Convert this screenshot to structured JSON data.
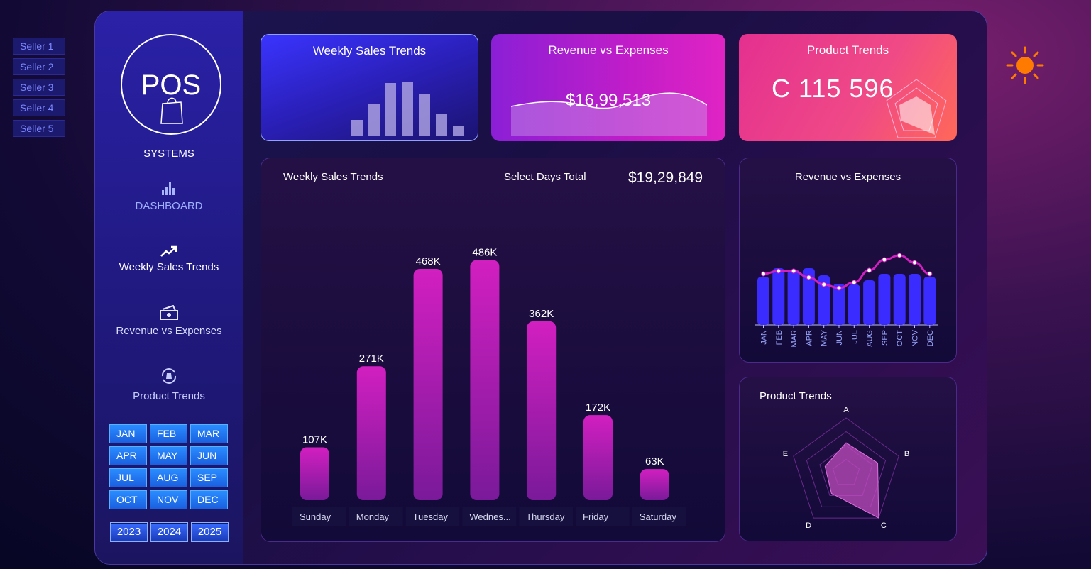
{
  "sellers": [
    "Seller 1",
    "Seller 2",
    "Seller 3",
    "Seller 4",
    "Seller 5"
  ],
  "logo": {
    "text": "POS",
    "subtitle": "SYSTEMS"
  },
  "nav": {
    "dashboard": "DASHBOARD",
    "weekly": "Weekly Sales Trends",
    "revenue": "Revenue vs Expenses",
    "product": "Product Trends"
  },
  "months": [
    "JAN",
    "FEB",
    "MAR",
    "APR",
    "MAY",
    "JUN",
    "JUL",
    "AUG",
    "SEP",
    "OCT",
    "NOV",
    "DEC"
  ],
  "years": [
    "2023",
    "2024",
    "2025"
  ],
  "cards": {
    "weekly_title": "Weekly Sales Trends",
    "revenue_title": "Revenue vs Expenses",
    "revenue_value": "$16,99,513",
    "product_title": "Product Trends",
    "product_value": "C  115 596"
  },
  "main_panel": {
    "title": "Weekly Sales Trends",
    "total_label": "Select Days Total",
    "total_value": "$19,29,849"
  },
  "rev_panel": {
    "title": "Revenue vs Expenses"
  },
  "prod_panel": {
    "title": "Product Trends"
  },
  "colors": {
    "accent_magenta": "#d21fc0",
    "bar_blue": "#3a2cff",
    "sun": "#ff7a00"
  },
  "chart_data": [
    {
      "type": "bar",
      "categories": [
        "Sunday",
        "Monday",
        "Tuesday",
        "Wednes...",
        "Thursday",
        "Friday",
        "Saturday"
      ],
      "values": [
        107,
        271,
        468,
        486,
        362,
        172,
        63
      ],
      "labels": [
        "107K",
        "271K",
        "468K",
        "486K",
        "362K",
        "172K",
        "63K"
      ],
      "ylim": [
        0,
        500
      ]
    },
    {
      "type": "bar",
      "categories": [
        "JAN",
        "FEB",
        "MAR",
        "APR",
        "MAY",
        "JUN",
        "JUL",
        "AUG",
        "SEP",
        "OCT",
        "NOV",
        "DEC"
      ],
      "series": [
        {
          "type": "bar",
          "values": [
            68,
            80,
            78,
            80,
            70,
            58,
            57,
            63,
            72,
            72,
            72,
            68
          ]
        },
        {
          "type": "line",
          "values": [
            72,
            76,
            76,
            67,
            57,
            52,
            60,
            77,
            92,
            98,
            88,
            72
          ]
        }
      ],
      "ylim": [
        0,
        100
      ]
    },
    {
      "type": "radar",
      "axes": [
        "A",
        "B",
        "C",
        "D",
        "E"
      ],
      "values": [
        0.55,
        0.6,
        1.0,
        0.45,
        0.4
      ],
      "rlim": [
        0,
        1
      ]
    }
  ]
}
